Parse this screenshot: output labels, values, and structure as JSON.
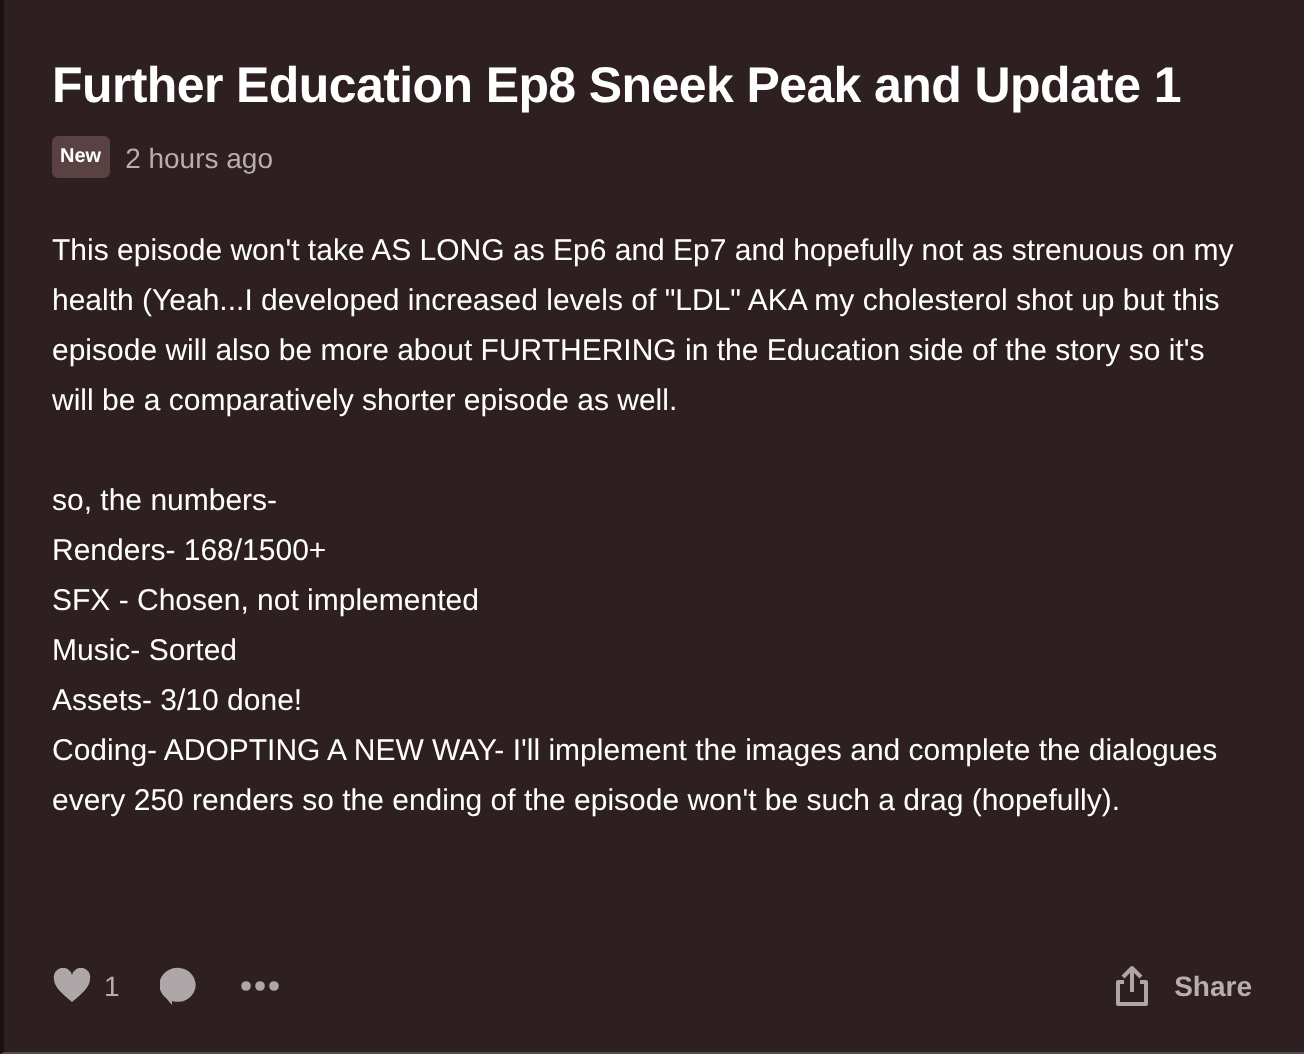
{
  "post": {
    "title": "Further Education Ep8 Sneek Peak and Update 1",
    "badge": "New",
    "time": "2 hours ago",
    "paragraphs": [
      "This episode won't take AS LONG as Ep6 and Ep7 and hopefully not as strenuous on my health (Yeah...I developed increased levels of \"LDL\" AKA my cholesterol shot up but this episode will also be more about FURTHERING in the Education side of the story so it's will be a comparatively shorter episode as well.",
      "so, the numbers-",
      "Renders- 168/1500+",
      "SFX - Chosen, not implemented",
      "Music- Sorted",
      "Assets- 3/10 done!",
      "Coding- ADOPTING A NEW WAY- I'll implement the images and complete the dialogues every 250 renders so the ending of the episode won't be such a drag (hopefully)."
    ]
  },
  "actions": {
    "like_count": "1",
    "share": "Share"
  }
}
